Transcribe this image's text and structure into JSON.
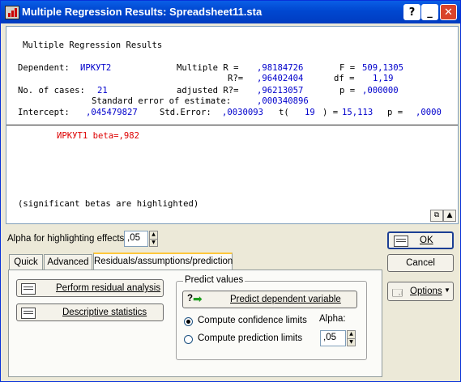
{
  "window": {
    "title": "Multiple Regression Results: Spreadsheet11.sta",
    "help_label": "?",
    "minimize_label": "_",
    "close_label": "✕"
  },
  "output": {
    "heading": "Multiple Regression Results",
    "dependent_label": "Dependent:",
    "dependent_value": "ИРКУТ2",
    "multiple_r_label": "Multiple R =",
    "multiple_r_value": ",98184726",
    "f_label": "F =",
    "f_value": "509,1305",
    "r2_label": "R?=",
    "r2_value": ",96402404",
    "df_label": "df =",
    "df_value": "1,19",
    "cases_label": "No. of cases:",
    "cases_value": "21",
    "adj_r2_label": "adjusted R?=",
    "adj_r2_value": ",96213057",
    "p_label": "p =",
    "p_value": ",000000",
    "se_label": "Standard error of estimate:",
    "se_value": ",000340896",
    "intercept_label": "Intercept:",
    "intercept_value": ",045479827",
    "stderr_label": "Std.Error:",
    "stderr_value": ",0030093",
    "t_label": "t(",
    "t_df": "19",
    "t_close": ") =",
    "t_value": "15,113",
    "p2_label": "p =",
    "p2_value": ",0000",
    "beta_line": "ИРКУТ1 beta=,982",
    "note": "(significant betas are highlighted)"
  },
  "controls": {
    "alpha_label": "Alpha for highlighting effects:",
    "alpha_value": ",05",
    "ok_label": "OK",
    "cancel_label": "Cancel",
    "options_label": "Options",
    "tabs": [
      "Quick",
      "Advanced",
      "Residuals/assumptions/prediction"
    ],
    "perform_residual_label": "Perform residual analysis",
    "descriptive_stats_label": "Descriptive statistics",
    "predict_group_label": "Predict values",
    "predict_dependent_label": "Predict dependent variable",
    "confidence_label": "Compute confidence limits",
    "prediction_label": "Compute prediction limits",
    "pred_alpha_label": "Alpha:",
    "pred_alpha_value": ",05"
  }
}
